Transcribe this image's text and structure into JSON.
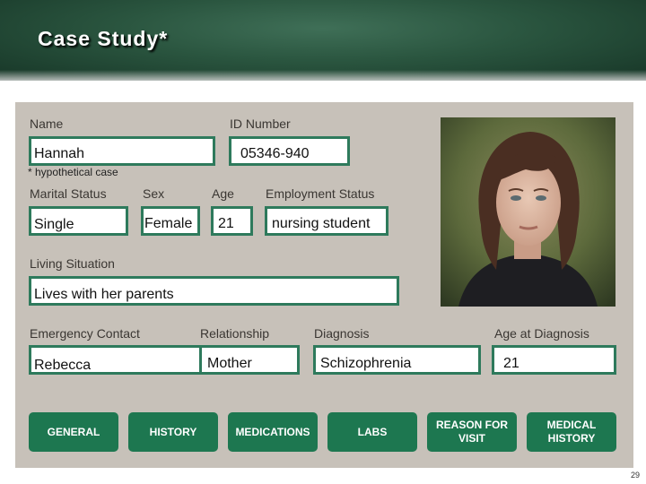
{
  "slide": {
    "title": "Case Study*",
    "note": "* hypothetical case",
    "page_number": "29"
  },
  "form": {
    "name_label": "Name",
    "name_value": "Hannah",
    "id_label": "ID Number",
    "id_value": "05346-940",
    "marital_label": "Marital Status",
    "marital_value": "Single",
    "sex_label": "Sex",
    "sex_value": "Female",
    "age_label": "Age",
    "age_value": "21",
    "employment_label": "Employment Status",
    "employment_value": "nursing student",
    "living_label": "Living Situation",
    "living_value": "Lives with her parents",
    "emergency_label": "Emergency Contact",
    "emergency_value": "Rebecca",
    "relationship_label": "Relationship",
    "relationship_value": "Mother",
    "diagnosis_label": "Diagnosis",
    "diagnosis_value": "Schizophrenia",
    "age_diag_label": "Age at Diagnosis",
    "age_diag_value": "21"
  },
  "photo": {
    "icon": "patient-portrait"
  },
  "buttons": [
    {
      "label": "GENERAL"
    },
    {
      "label": "HISTORY"
    },
    {
      "label": "MEDICATIONS"
    },
    {
      "label": "LABS"
    },
    {
      "label": "REASON FOR VISIT"
    },
    {
      "label": "MEDICAL HISTORY"
    }
  ],
  "colors": {
    "accent": "#2e7a5c",
    "button": "#1d7750",
    "panel": "#c7c1b9",
    "header": "#2a553f"
  }
}
